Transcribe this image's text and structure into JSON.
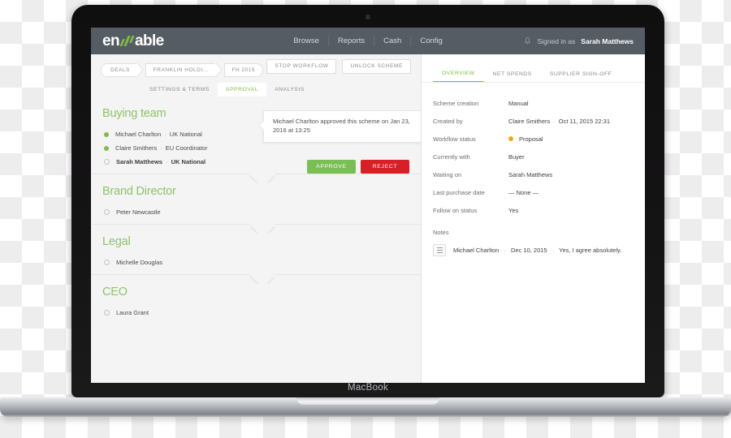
{
  "device": {
    "label": "MacBook"
  },
  "appbar": {
    "logo": {
      "prefix": "en",
      "suffix": "able",
      "icon": "enable-logo-slashes",
      "accent": "#7ebc4b"
    },
    "nav": [
      {
        "label": "Browse"
      },
      {
        "label": "Reports"
      },
      {
        "label": "Cash"
      },
      {
        "label": "Config"
      }
    ],
    "account": {
      "bell_icon": "bell-icon",
      "prefix": "Signed in as",
      "user": "Sarah Matthews"
    }
  },
  "breadcrumb": {
    "items": [
      {
        "label": "DEALS"
      },
      {
        "label": "FRANKLIN HOLDI..."
      },
      {
        "label": "FH 2015"
      }
    ]
  },
  "crumb_actions": [
    {
      "label": "STOP WORKFLOW"
    },
    {
      "label": "UNLOCK SCHEME"
    }
  ],
  "tabs": [
    {
      "label": "SETTINGS & TERMS",
      "active": false
    },
    {
      "label": "APPROVAL",
      "active": true
    },
    {
      "label": "ANALYSIS",
      "active": false
    }
  ],
  "approval": {
    "tooltip": "Michael Charlton approved this scheme on Jan 23, 2016 at 13:25",
    "approve_label": "APPROVE",
    "reject_label": "REJECT",
    "sections": [
      {
        "title": "Buying team",
        "members": [
          {
            "name": "Michael Charlton",
            "role": "UK National",
            "status": "done",
            "bold": false
          },
          {
            "name": "Claire Smithers",
            "role": "EU Coordinator",
            "status": "done",
            "bold": false
          },
          {
            "name": "Sarah Matthews",
            "role": "UK National",
            "status": "pending",
            "bold": true
          }
        ]
      },
      {
        "title": "Brand Director",
        "members": [
          {
            "name": "Peter Newcastle",
            "role": "",
            "status": "pending",
            "bold": false
          }
        ]
      },
      {
        "title": "Legal",
        "members": [
          {
            "name": "Michelle Douglas",
            "role": "",
            "status": "pending",
            "bold": false
          }
        ]
      },
      {
        "title": "CEO",
        "members": [
          {
            "name": "Laura Grant",
            "role": "",
            "status": "pending",
            "bold": false
          }
        ]
      }
    ]
  },
  "right_panel": {
    "tabs": [
      {
        "label": "OVERVIEW",
        "active": true
      },
      {
        "label": "NET SPENDS",
        "active": false
      },
      {
        "label": "SUPPLIER SIGN-OFF",
        "active": false
      }
    ],
    "details": [
      {
        "label": "Scheme creation",
        "value": "Manual"
      },
      {
        "label": "Created by",
        "value": "Claire Smithers",
        "value2": "Oct 11, 2015 22:31"
      },
      {
        "label": "Workflow status",
        "value": "Proposal",
        "status_color": "#f0a81e"
      },
      {
        "label": "Currently with",
        "value": "Buyer"
      },
      {
        "label": "Waiting on",
        "value": "Sarah Matthews"
      },
      {
        "label": "Last purchase date",
        "value": "— None —"
      },
      {
        "label": "Follow on status",
        "value": "Yes"
      }
    ],
    "notes_label": "Notes",
    "note": {
      "icon": "list-icon",
      "author": "Michael Charlton",
      "date": "Dec 10, 2015",
      "text": "Yes, I agree absolutely."
    }
  },
  "colors": {
    "brand_green": "#7ebc4b",
    "heading_green": "#8dc26a",
    "reject_red": "#d81f26",
    "status_amber": "#f0a81e",
    "appbar_grey": "#555c63"
  }
}
